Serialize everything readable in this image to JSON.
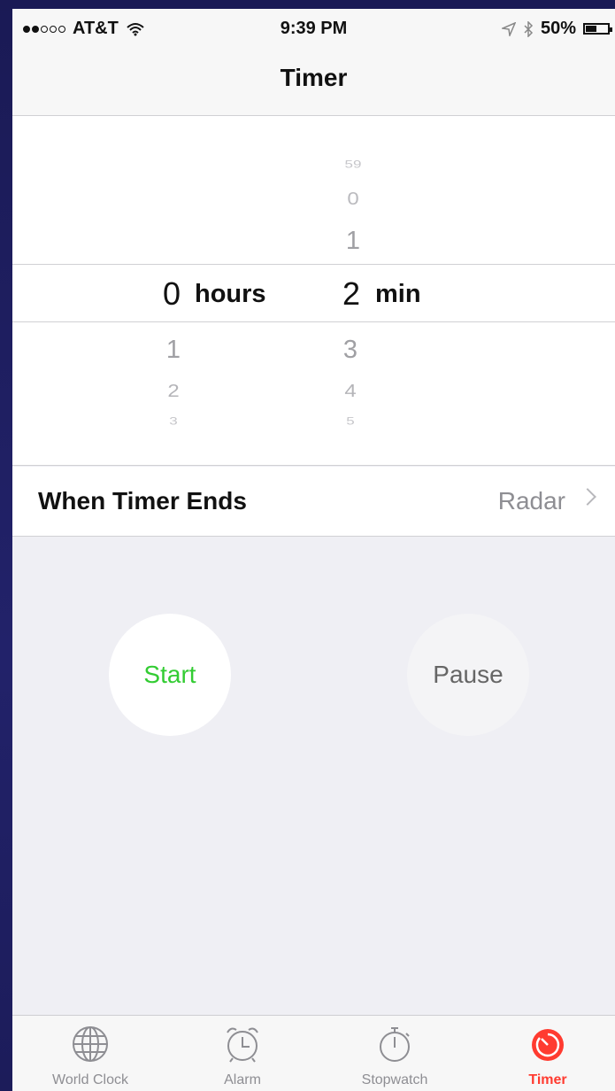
{
  "status_bar": {
    "carrier": "AT&T",
    "time": "9:39 PM",
    "battery": "50%",
    "battery_level": 0.5
  },
  "nav": {
    "title": "Timer"
  },
  "picker": {
    "hours_above": [],
    "minutes_above": [
      "59",
      "0",
      "1"
    ],
    "selected_hours": "0",
    "hours_unit": "hours",
    "selected_minutes": "2",
    "minutes_unit": "min",
    "hours_below": [
      "1",
      "2",
      "3"
    ],
    "minutes_below": [
      "3",
      "4",
      "5"
    ]
  },
  "when_timer_ends": {
    "label": "When Timer Ends",
    "value": "Radar"
  },
  "buttons": {
    "start": "Start",
    "pause": "Pause"
  },
  "tabs": [
    {
      "label": "World Clock",
      "icon": "globe-icon"
    },
    {
      "label": "Alarm",
      "icon": "alarm-clock-icon"
    },
    {
      "label": "Stopwatch",
      "icon": "stopwatch-icon"
    },
    {
      "label": "Timer",
      "icon": "timer-icon",
      "active": true
    }
  ],
  "colors": {
    "accent": "#ff3b30",
    "start": "#33cc33"
  }
}
